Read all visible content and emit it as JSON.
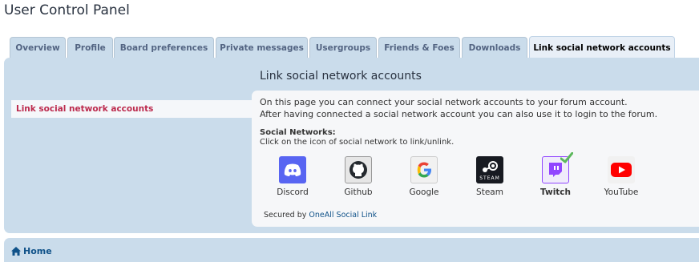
{
  "page_title": "User Control Panel",
  "tabs": [
    {
      "label": "Overview"
    },
    {
      "label": "Profile"
    },
    {
      "label": "Board preferences"
    },
    {
      "label": "Private messages"
    },
    {
      "label": "Usergroups"
    },
    {
      "label": "Friends & Foes"
    },
    {
      "label": "Downloads"
    },
    {
      "label": "Link social network accounts",
      "active": true
    }
  ],
  "sidebar": {
    "item": "Link social network accounts"
  },
  "content": {
    "title": "Link social network accounts",
    "intro_line1": "On this page you can connect your social network accounts to your forum account.",
    "intro_line2": "After having connected a social network account you can also use it to login to the forum.",
    "social_label": "Social Networks:",
    "social_hint": "Click on the icon of social network to link/unlink."
  },
  "networks": [
    {
      "label": "Discord",
      "icon": "discord-icon",
      "color": "#5865f2"
    },
    {
      "label": "Github",
      "icon": "github-icon",
      "color": "#24292e"
    },
    {
      "label": "Google",
      "icon": "google-icon",
      "color": "#4285f4"
    },
    {
      "label": "Steam",
      "icon": "steam-icon",
      "color": "#171a21"
    },
    {
      "label": "Twitch",
      "icon": "twitch-icon",
      "color": "#9146ff",
      "linked": true
    },
    {
      "label": "YouTube",
      "icon": "youtube-icon",
      "color": "#ff0000"
    }
  ],
  "secured": {
    "prefix": "Secured by",
    "link": "OneAll Social Link"
  },
  "footer": {
    "home": "Home"
  }
}
